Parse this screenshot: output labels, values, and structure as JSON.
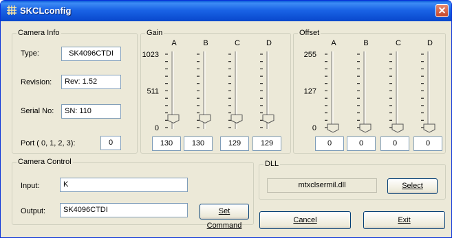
{
  "window": {
    "title": "SKCLconfig"
  },
  "camera_info": {
    "legend": "Camera Info",
    "type_label": "Type:",
    "type_value": "SK4096CTDI",
    "revision_label": "Revision:",
    "revision_value": "Rev: 1.52",
    "serial_label": "Serial No:",
    "serial_value": "SN: 110",
    "port_label": "Port ( 0, 1, 2, 3):",
    "port_value": "0"
  },
  "gain": {
    "legend": "Gain",
    "scale": [
      "1023",
      "511",
      "0"
    ],
    "max": 1023,
    "channels": [
      {
        "name": "A",
        "value": "130"
      },
      {
        "name": "B",
        "value": "130"
      },
      {
        "name": "C",
        "value": "129"
      },
      {
        "name": "D",
        "value": "129"
      }
    ]
  },
  "offset": {
    "legend": "Offset",
    "scale": [
      "255",
      "127",
      "0"
    ],
    "max": 255,
    "channels": [
      {
        "name": "A",
        "value": "0"
      },
      {
        "name": "B",
        "value": "0"
      },
      {
        "name": "C",
        "value": "0"
      },
      {
        "name": "D",
        "value": "0"
      }
    ]
  },
  "camera_control": {
    "legend": "Camera Control",
    "input_label": "Input:",
    "input_value": "K",
    "output_label": "Output:",
    "output_value": "SK4096CTDI",
    "set_command_label": "Set Command"
  },
  "dll": {
    "legend": "DLL",
    "file": "mtxclsermil.dll",
    "select_label": "Select"
  },
  "buttons": {
    "cancel": "Cancel",
    "exit": "Exit"
  },
  "colors": {
    "title_bar": "#0a5ad8",
    "window_bg": "#ece9d8",
    "close_button": "#c4452a"
  }
}
